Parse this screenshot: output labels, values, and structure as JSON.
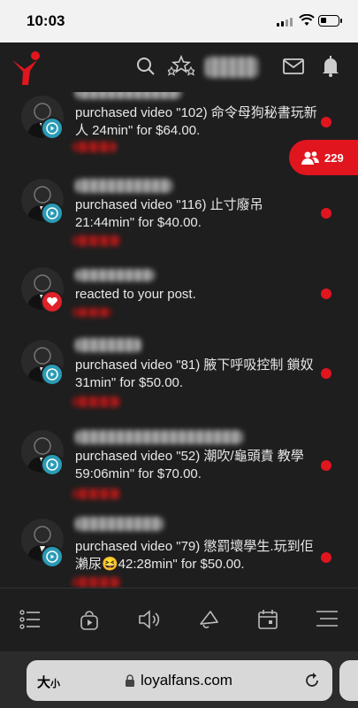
{
  "status": {
    "time": "10:03"
  },
  "fab": {
    "count": "229"
  },
  "feed": [
    {
      "text": "purchased video \"102) 命令母狗秘書玩新人 24min\" for $64.00.",
      "badge": "play"
    },
    {
      "text": "purchased video \"116) 止寸廢吊 21:44min\" for $40.00.",
      "badge": "play"
    },
    {
      "text": "reacted to your post.",
      "badge": "heart"
    },
    {
      "text": "purchased video \"81) 腋下呼吸控制 鎖奴 31min\" for $50.00.",
      "badge": "play"
    },
    {
      "text": "purchased video \"52) 潮吹/龜頭責 教學 59:06min\" for $70.00.",
      "badge": "play"
    },
    {
      "text": "purchased video \"79) 懲罰壞學生.玩到佢瀨尿😆42:28min\" for $50.00.",
      "badge": "play"
    }
  ],
  "browser": {
    "text_size_label": "大",
    "text_size_small": "小",
    "url": "loyalfans.com"
  },
  "colors": {
    "accent": "#e0151e",
    "play_badge": "#2a9bb5",
    "background": "#1e1e1e"
  }
}
